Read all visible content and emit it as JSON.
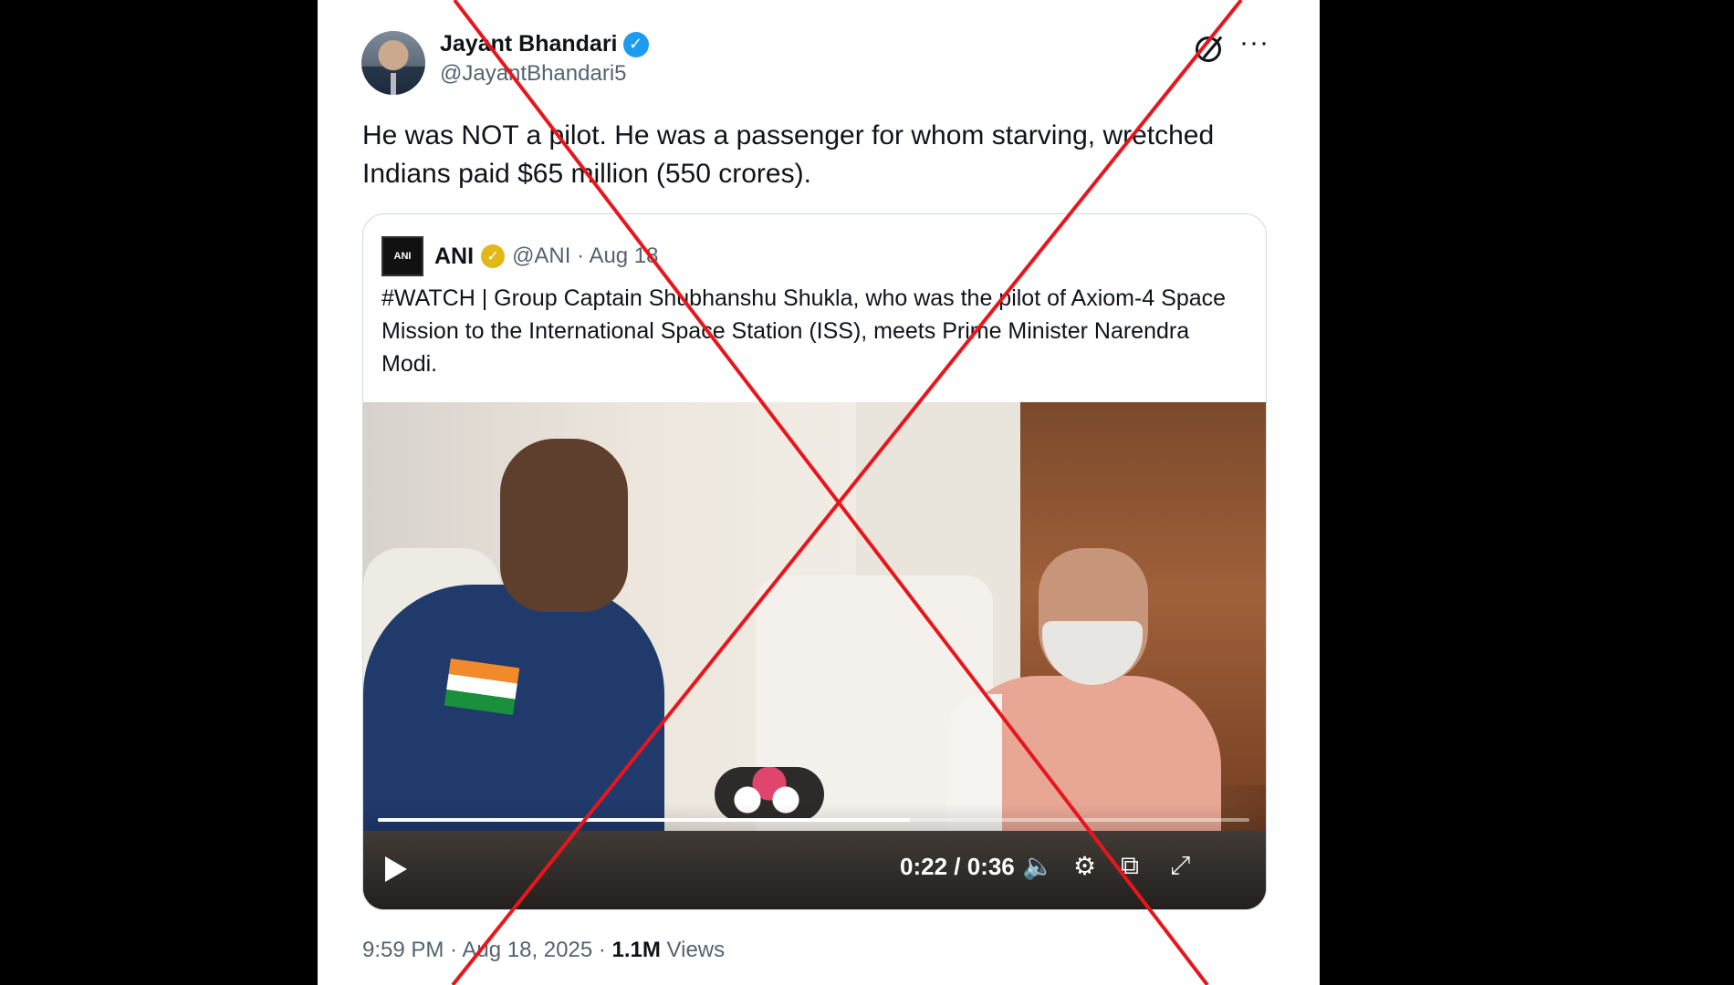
{
  "author": {
    "name": "Jayant Bhandari",
    "handle": "@JayantBhandari5",
    "verified_mark": "✓"
  },
  "tweet": {
    "text": "He was NOT a pilot. He was a passenger for whom starving, wretched Indians paid $65 million (550 crores).",
    "more_glyph": "···"
  },
  "quote": {
    "logo_text": "ANI",
    "name": "ANI",
    "verified_mark": "✓",
    "handle_date": "@ANI · Aug 18",
    "text": "#WATCH | Group Captain Shubhanshu Shukla, who was the pilot of Axiom-4 Space Mission to the International Space Station (ISS), meets Prime Minister Narendra Modi."
  },
  "video": {
    "time": "0:22 / 0:36",
    "progress_fraction": 0.61,
    "icons": [
      "play-icon",
      "volume-icon",
      "settings-icon",
      "pip-icon",
      "fullscreen-icon"
    ]
  },
  "footer": {
    "time_date": "9:59 PM · Aug 18, 2025 · ",
    "views_count": "1.1M",
    "views_label": " Views"
  },
  "colors": {
    "overlay_cross": "#e8161c",
    "verified_blue": "#1d9bf0",
    "verified_gold": "#e2b719"
  }
}
